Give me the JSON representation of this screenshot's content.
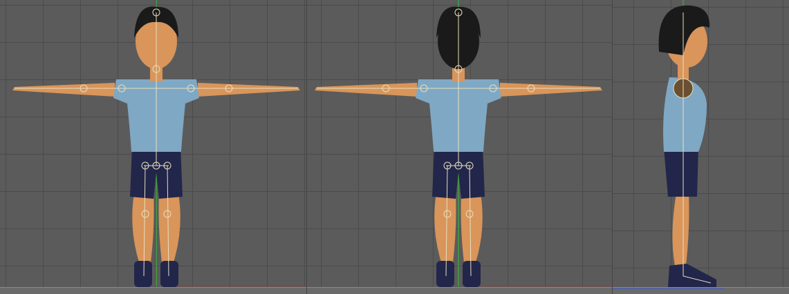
{
  "viewports": [
    {
      "view": "front"
    },
    {
      "view": "back"
    },
    {
      "view": "side"
    }
  ],
  "colors": {
    "background": "#5b5b5b",
    "grid": "#4b4b4b",
    "skin": "#d9955a",
    "shirt": "#7fa8c4",
    "shorts": "#22264a",
    "hair": "#1a1a1a",
    "bones": "#e8e0c0",
    "axis_y": "#3fa03f",
    "axis_x": "#b03030"
  }
}
